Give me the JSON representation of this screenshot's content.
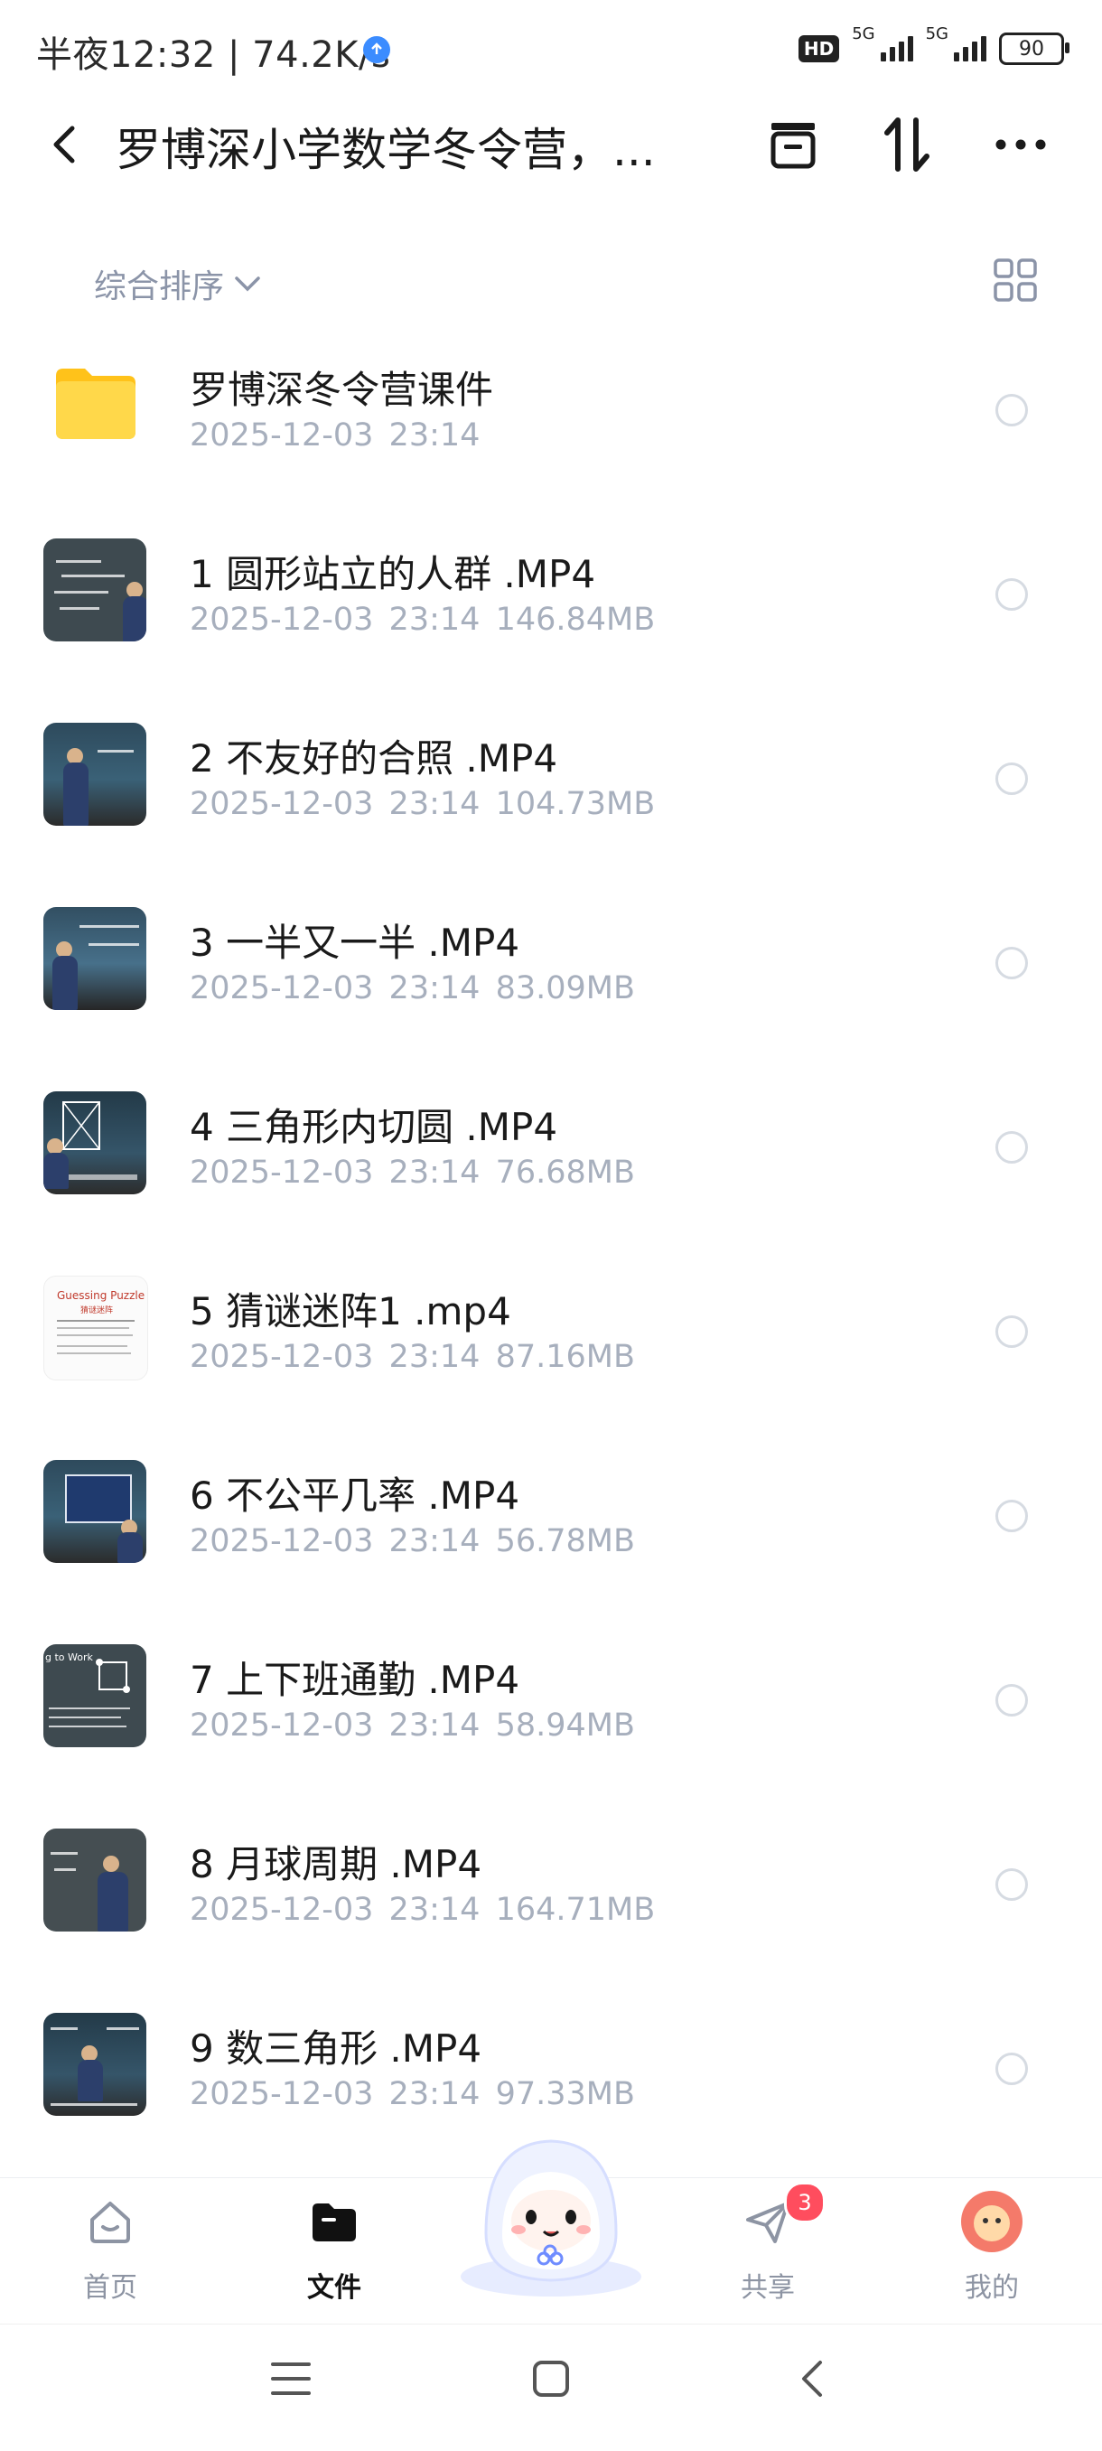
{
  "status": {
    "time": "半夜12:32 | 74.2K/s",
    "hd_label": "HD",
    "net1": "5G",
    "net2": "5G",
    "battery": "90"
  },
  "header": {
    "title": "罗博深小学数学冬令营，..."
  },
  "sort": {
    "label": "综合排序"
  },
  "files": [
    {
      "name": "罗博深冬令营课件",
      "date": "2025-12-03",
      "time": "23:14",
      "size": "",
      "kind": "folder"
    },
    {
      "name": "1 圆形站立的人群 .MP4",
      "date": "2025-12-03",
      "time": "23:14",
      "size": "146.84MB",
      "kind": "video"
    },
    {
      "name": "2 不友好的合照 .MP4",
      "date": "2025-12-03",
      "time": "23:14",
      "size": "104.73MB",
      "kind": "video"
    },
    {
      "name": "3 一半又一半 .MP4",
      "date": "2025-12-03",
      "time": "23:14",
      "size": "83.09MB",
      "kind": "video"
    },
    {
      "name": "4 三角形内切圆 .MP4",
      "date": "2025-12-03",
      "time": "23:14",
      "size": "76.68MB",
      "kind": "video"
    },
    {
      "name": "5 猜谜迷阵1 .mp4",
      "date": "2025-12-03",
      "time": "23:14",
      "size": "87.16MB",
      "kind": "video"
    },
    {
      "name": "6 不公平几率 .MP4",
      "date": "2025-12-03",
      "time": "23:14",
      "size": "56.78MB",
      "kind": "video"
    },
    {
      "name": "7 上下班通勤 .MP4",
      "date": "2025-12-03",
      "time": "23:14",
      "size": "58.94MB",
      "kind": "video"
    },
    {
      "name": "8 月球周期 .MP4",
      "date": "2025-12-03",
      "time": "23:14",
      "size": "164.71MB",
      "kind": "video"
    },
    {
      "name": "9 数三角形 .MP4",
      "date": "2025-12-03",
      "time": "23:14",
      "size": "97.33MB",
      "kind": "video"
    }
  ],
  "thumb_text": {
    "slide_title": "Guessing Puzzle",
    "slide_sub": "猜谜迷阵",
    "commute": "g to Work"
  },
  "nav": {
    "home": "首页",
    "files": "文件",
    "share": "共享",
    "share_badge": "3",
    "me": "我的"
  },
  "colors": {
    "accent_text": "#1a1a1a",
    "meta_text": "#a7afbd",
    "folder": "#ffd23a",
    "badge": "#ff4d5e"
  }
}
